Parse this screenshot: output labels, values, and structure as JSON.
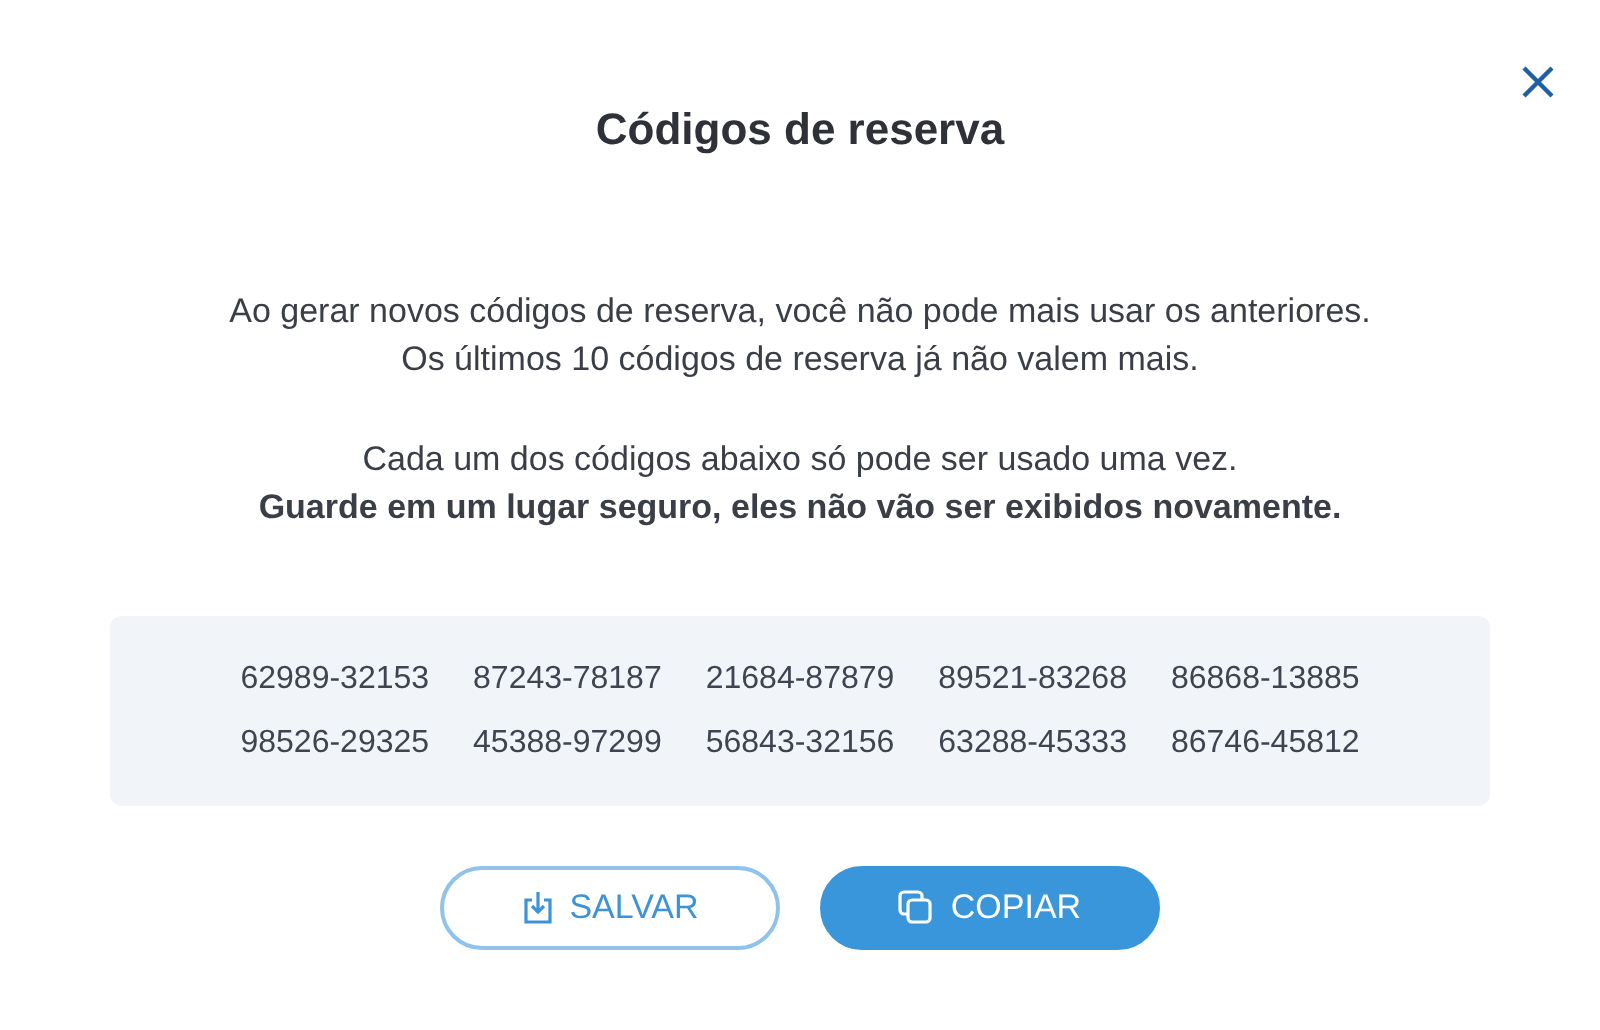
{
  "dialog": {
    "title": "Códigos de reserva",
    "paragraphs": [
      {
        "lines": [
          "Ao gerar novos códigos de reserva, você não pode mais usar os anteriores.",
          "Os últimos 10 códigos de reserva já não valem mais."
        ]
      },
      {
        "lines": [
          "Cada um dos códigos abaixo só pode ser usado uma vez.",
          "**Guarde em um lugar seguro, eles não vão ser exibidos novamente.**"
        ]
      }
    ],
    "codes": [
      "62989-32153",
      "87243-78187",
      "21684-87879",
      "89521-83268",
      "86868-13885",
      "98526-29325",
      "45388-97299",
      "56843-32156",
      "63288-45333",
      "86746-45812"
    ],
    "buttons": [
      {
        "label": "SALVAR",
        "kind": "outline"
      },
      {
        "label": "COPIAR",
        "kind": "filled"
      }
    ]
  }
}
